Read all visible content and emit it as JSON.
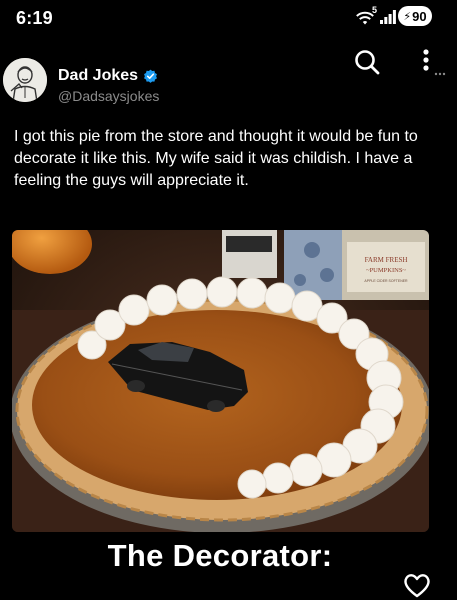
{
  "status_bar": {
    "time": "6:19",
    "network_badge": "5",
    "battery": "90"
  },
  "icons": {
    "wifi": "wifi-icon",
    "signal": "signal-bars-icon",
    "battery": "battery-charging-icon",
    "search": "search-icon",
    "more": "more-vertical-icon",
    "verified": "verified-badge-icon",
    "like": "heart-outline-icon"
  },
  "tweet": {
    "author_name": "Dad Jokes",
    "handle": "@Dadsaysjokes",
    "text": "I got this pie from the store and thought it would be fun to decorate it like this. My wife said it was childish. I have a feeling the guys will appreciate it."
  },
  "media": {
    "description_labels": {
      "box_brand": "FARM FRESH",
      "box_product": "~PUMPKINS~",
      "box_line": "APPLE CIDER SOFTENER"
    }
  },
  "overlay": {
    "caption": "The Decorator:"
  },
  "colors": {
    "background": "#000000",
    "text": "#ffffff",
    "secondary_text": "#8b8b8b",
    "verified_blue": "#1d9bf0"
  }
}
